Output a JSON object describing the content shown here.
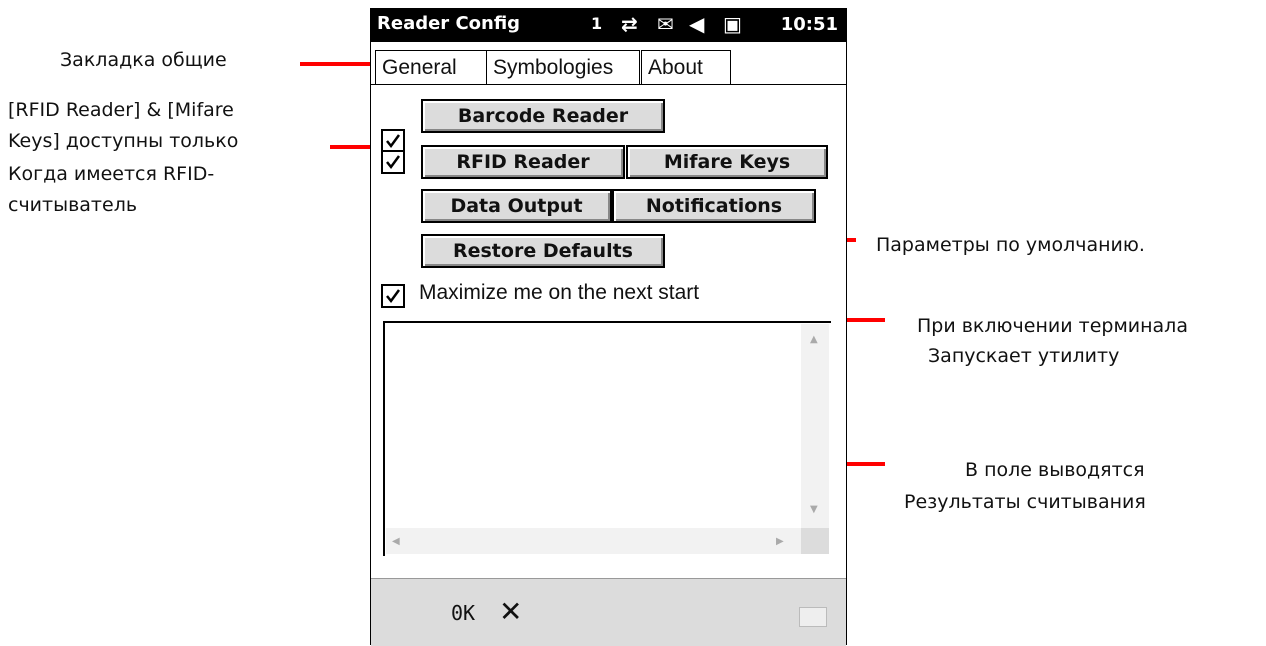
{
  "annotations": {
    "tab_general": "Закладка общие",
    "rfid_note_lines": [
      "[RFID Reader] & [Mifare",
      "Keys] доступны только",
      "Когда имеется RFID-",
      "считыватель"
    ],
    "restore_defaults": "Параметры по умолчанию.",
    "autostart_lines": [
      "При включении терминала",
      "Запускает утилиту"
    ],
    "output_lines": [
      "В поле выводятся",
      "Результаты считывания"
    ]
  },
  "titlebar": {
    "title": "Reader Config",
    "signal": "1",
    "time": "10:51"
  },
  "tabs": [
    "General",
    "Symbologies",
    "About"
  ],
  "buttons": {
    "barcode_reader": "Barcode Reader",
    "rfid_reader": "RFID Reader",
    "mifare_keys": "Mifare Keys",
    "data_output": "Data Output",
    "notifications": "Notifications",
    "restore_defaults": "Restore Defaults"
  },
  "checkboxes": {
    "barcode_reader": true,
    "rfid_reader": true,
    "maximize": true
  },
  "maximize_label": "Maximize me on the next start",
  "bottombar": {
    "ok": "0K",
    "close": "✕"
  },
  "colors": {
    "annotation_line": "#ff0000",
    "button_face": "#dcdcdc",
    "titlebar": "#000000"
  }
}
